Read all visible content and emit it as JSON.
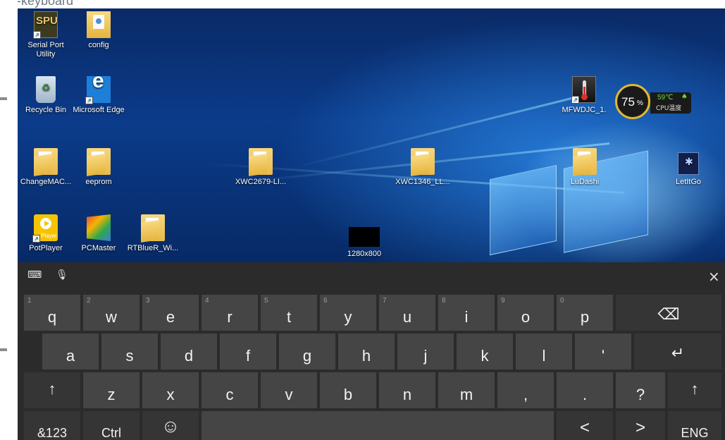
{
  "caption": "On-keyboard",
  "desktop": {
    "icons": {
      "serial_port": "Serial Port Utility",
      "config": "config",
      "recycle_bin": "Recycle Bin",
      "edge": "Microsoft Edge",
      "changemac": "ChangeMAC...",
      "eeprom": "eeprom",
      "xwc2679": "XWC2679-LI...",
      "xwc1346": "XWC1346_LL...",
      "ludashi": "LuDashi",
      "letitgo": "LetItGo",
      "potplayer": "PotPlayer",
      "pcmaster": "PCMaster",
      "rtbluer": "RTBlueR_Wi...",
      "mfwdjc": "MFWDJC_1.",
      "resolution": "1280x800"
    },
    "widget": {
      "percent": "75",
      "percent_unit": "%",
      "temp": "59℃",
      "label": "CPU温度"
    },
    "spu_logo": "SPU",
    "potplayer_badge": "Player"
  },
  "keyboard": {
    "close": "×",
    "row1": [
      {
        "num": "1",
        "label": "q"
      },
      {
        "num": "2",
        "label": "w"
      },
      {
        "num": "3",
        "label": "e"
      },
      {
        "num": "4",
        "label": "r"
      },
      {
        "num": "5",
        "label": "t"
      },
      {
        "num": "6",
        "label": "y"
      },
      {
        "num": "7",
        "label": "u"
      },
      {
        "num": "8",
        "label": "i"
      },
      {
        "num": "9",
        "label": "o"
      },
      {
        "num": "0",
        "label": "p"
      }
    ],
    "backspace": "⌫",
    "row2": [
      "a",
      "s",
      "d",
      "f",
      "g",
      "h",
      "j",
      "k",
      "l",
      "'"
    ],
    "enter": "↵",
    "shift_left": "↑",
    "row3": [
      "z",
      "x",
      "c",
      "v",
      "b",
      "n",
      "m",
      ",",
      ".",
      "?"
    ],
    "shift_right": "↑",
    "symbols": "&123",
    "ctrl": "Ctrl",
    "emoji": "☺",
    "arrow_left": "<",
    "arrow_right": ">",
    "language": "ENG"
  }
}
